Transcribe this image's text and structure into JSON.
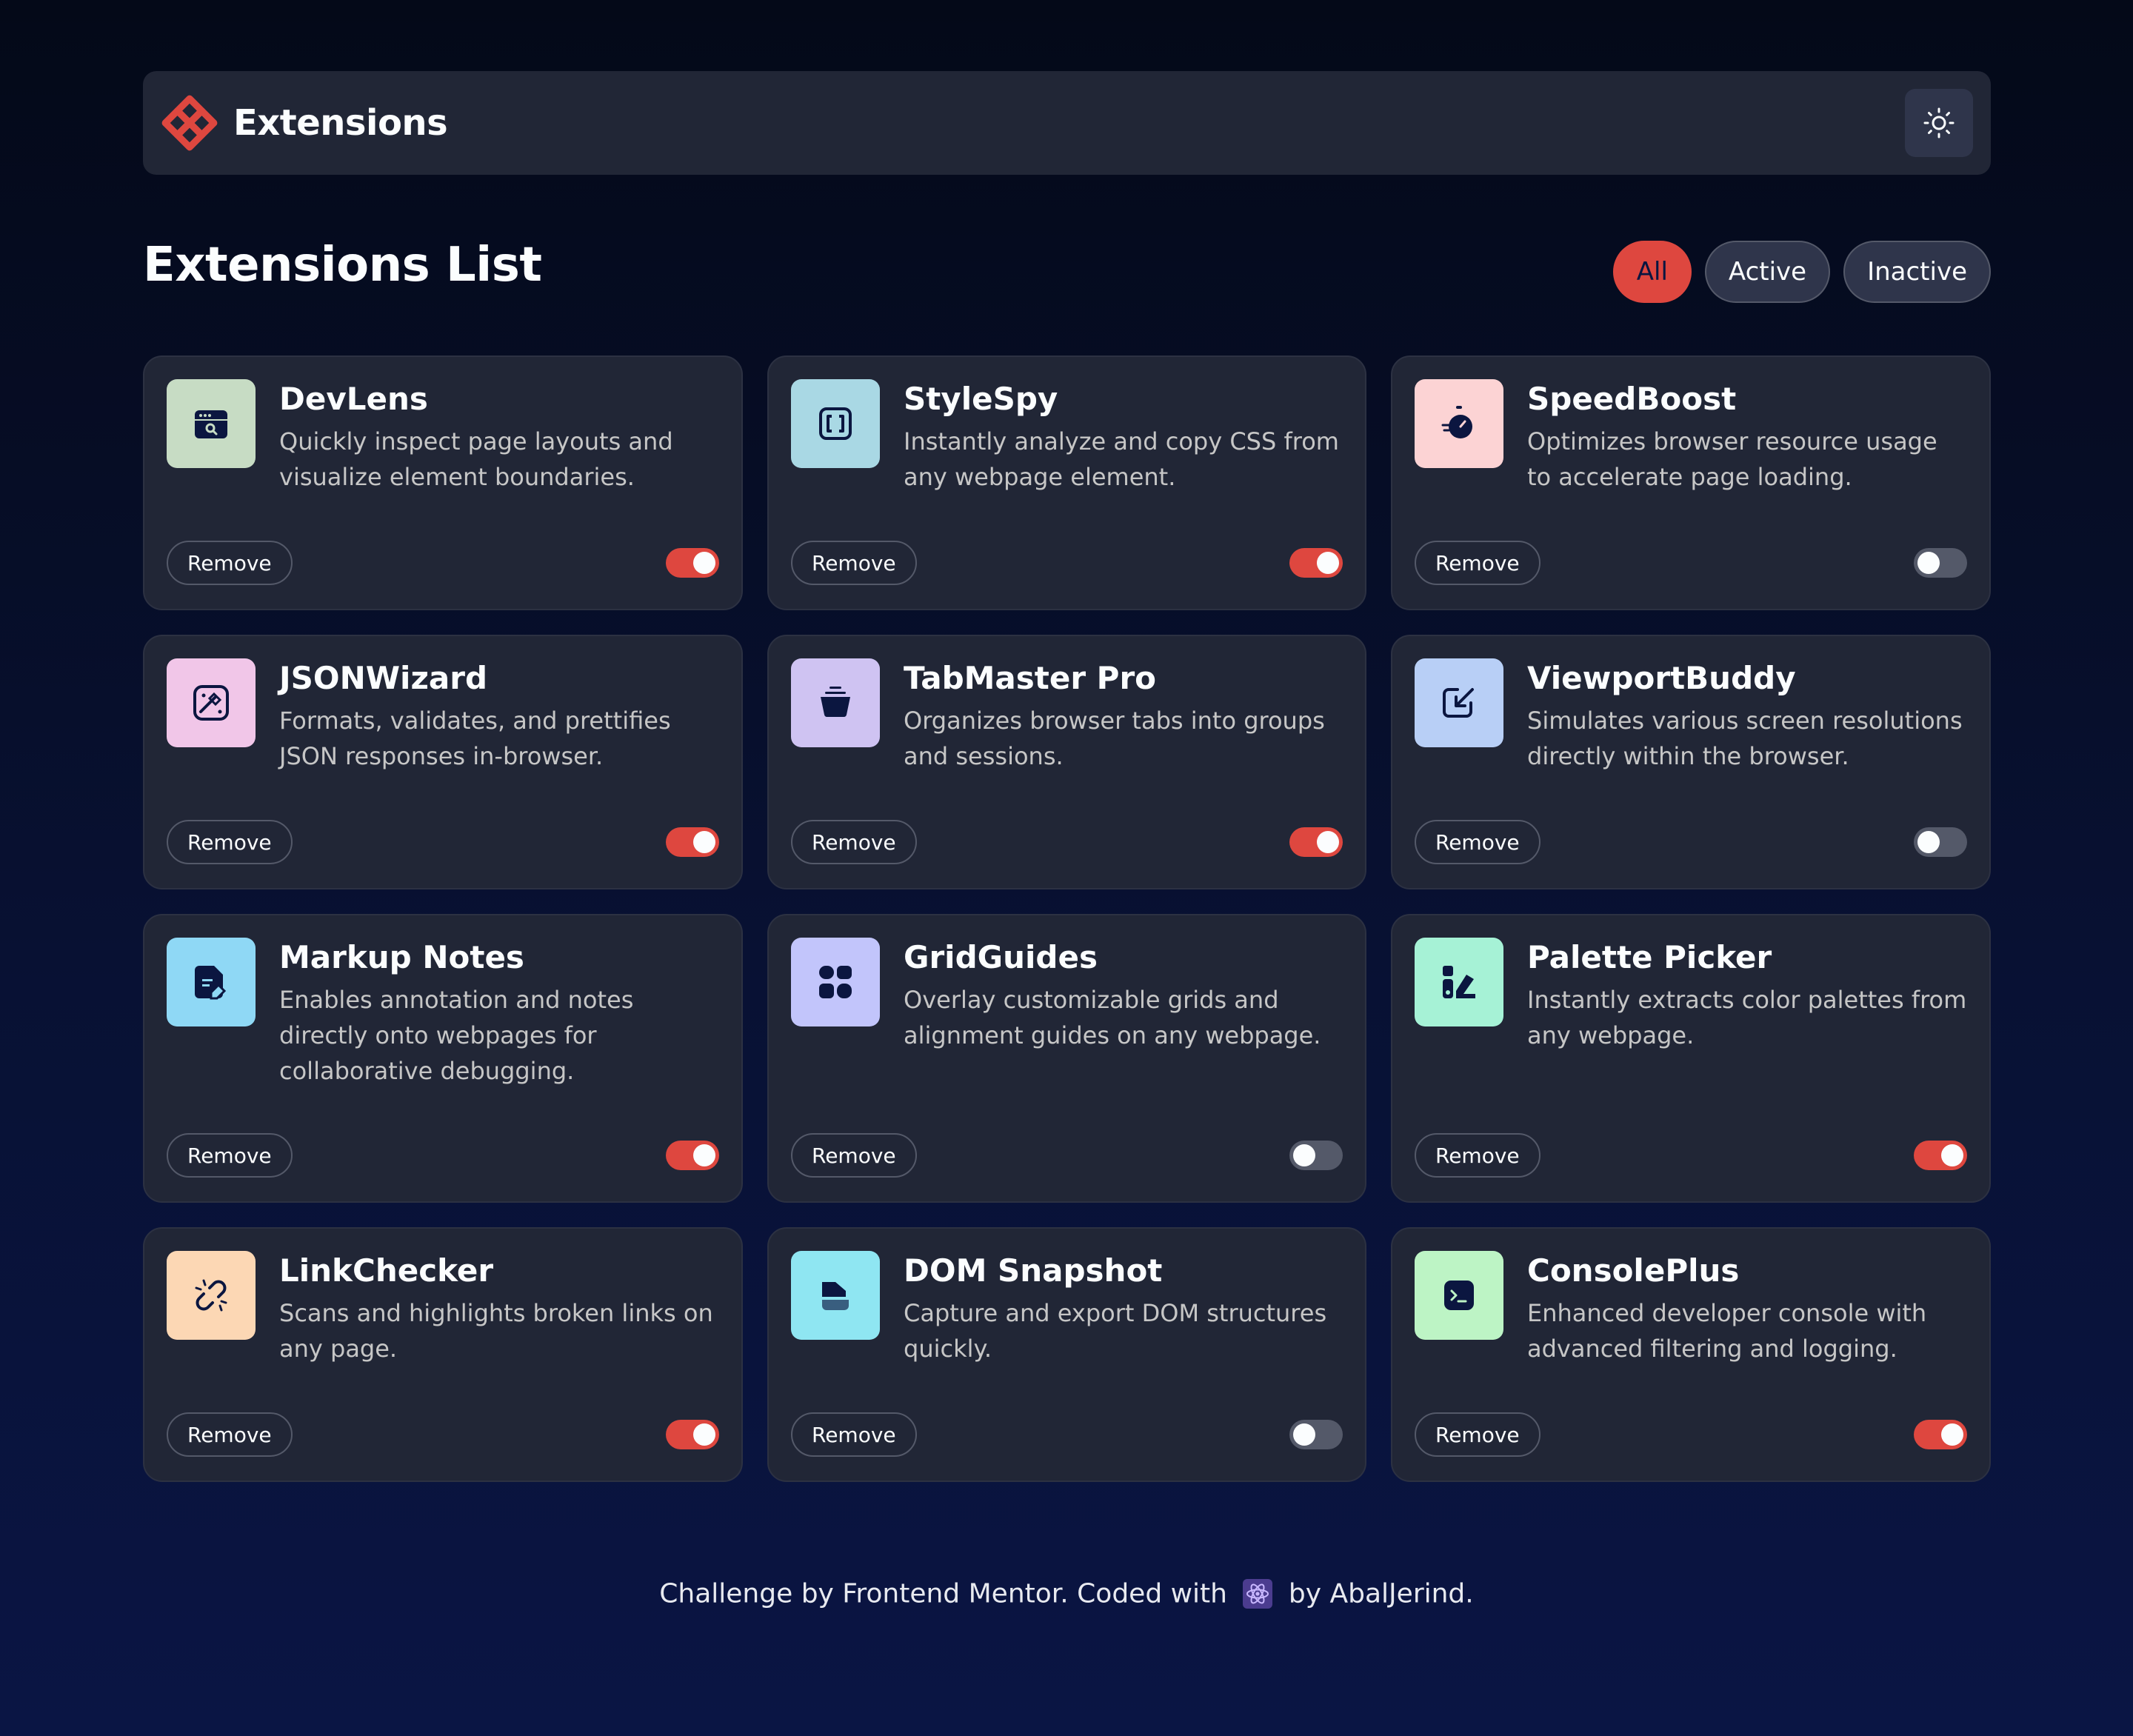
{
  "header": {
    "brand": "Extensions",
    "theme_icon": "sun-icon"
  },
  "page_title": "Extensions List",
  "filters": [
    {
      "label": "All",
      "selected": true
    },
    {
      "label": "Active",
      "selected": false
    },
    {
      "label": "Inactive",
      "selected": false
    }
  ],
  "remove_label": "Remove",
  "colors": {
    "accent": "#de473f",
    "toggle_off": "#545969",
    "card_bg": "#212636"
  },
  "extensions": [
    {
      "name": "DevLens",
      "description": "Quickly inspect page layouts and visualize element boundaries.",
      "active": true,
      "icon": "browser-search-icon",
      "tile_color": "#c7dcc4"
    },
    {
      "name": "StyleSpy",
      "description": "Instantly analyze and copy CSS from any webpage element.",
      "active": true,
      "icon": "brackets-icon",
      "tile_color": "#a9d8e4"
    },
    {
      "name": "SpeedBoost",
      "description": "Optimizes browser resource usage to accelerate page loading.",
      "active": false,
      "icon": "stopwatch-icon",
      "tile_color": "#fcd3d4"
    },
    {
      "name": "JSONWizard",
      "description": "Formats, validates, and prettifies JSON responses in-browser.",
      "active": true,
      "icon": "magic-wand-icon",
      "tile_color": "#f1c6e8"
    },
    {
      "name": "TabMaster Pro",
      "description": "Organizes browser tabs into groups and sessions.",
      "active": true,
      "icon": "stack-icon",
      "tile_color": "#cfc3f2"
    },
    {
      "name": "ViewportBuddy",
      "description": "Simulates various screen resolutions directly within the browser.",
      "active": false,
      "icon": "resize-arrow-icon",
      "tile_color": "#b8cff6"
    },
    {
      "name": "Markup Notes",
      "description": "Enables annotation and notes directly onto webpages for collaborative debugging.",
      "active": true,
      "icon": "note-pen-icon",
      "tile_color": "#8fd8f5"
    },
    {
      "name": "GridGuides",
      "description": "Overlay customizable grids and alignment guides on any webpage.",
      "active": false,
      "icon": "grid-icon",
      "tile_color": "#c2c5fb"
    },
    {
      "name": "Palette Picker",
      "description": "Instantly extracts color palettes from any webpage.",
      "active": true,
      "icon": "palette-icon",
      "tile_color": "#a6f2d6"
    },
    {
      "name": "LinkChecker",
      "description": "Scans and highlights broken links on any page.",
      "active": true,
      "icon": "broken-link-icon",
      "tile_color": "#fcd7b4"
    },
    {
      "name": "DOM Snapshot",
      "description": "Capture and export DOM structures quickly.",
      "active": false,
      "icon": "snapshot-icon",
      "tile_color": "#8fe6f2"
    },
    {
      "name": "ConsolePlus",
      "description": "Enhanced developer console with advanced filtering and logging.",
      "active": true,
      "icon": "terminal-icon",
      "tile_color": "#bdf4c5"
    }
  ],
  "footer": {
    "before": "Challenge by Frontend Mentor. Coded with",
    "after": "by AbalJerind.",
    "icon": "react-icon"
  }
}
